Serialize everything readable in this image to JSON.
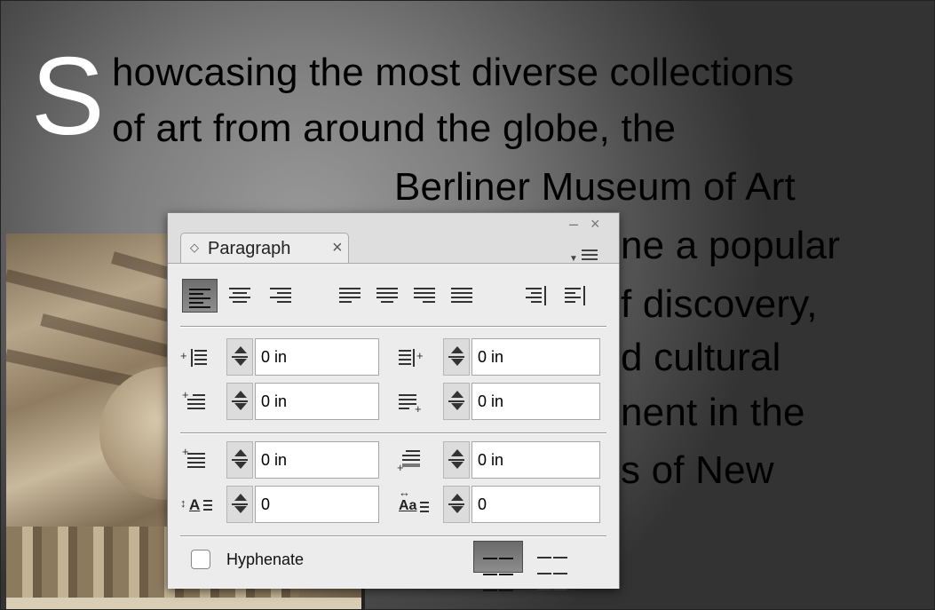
{
  "document": {
    "drop_cap": "S",
    "lines": [
      "howcasing the most diverse collections",
      "of art from around the globe, the",
      "Berliner Museum of Art",
      "ne a popular",
      "f discovery,",
      "d cultural",
      "nent in the",
      "s of New"
    ]
  },
  "panel": {
    "tab_label": "Paragraph",
    "tab_icon": "collapse-arrows-icon",
    "minimize_icon": "–",
    "close_icon": "×",
    "tab_close_icon": "×",
    "alignment_buttons": [
      "align-left",
      "align-center",
      "align-right",
      "justify-left",
      "justify-center",
      "justify-right",
      "justify-all",
      "align-towards-spine",
      "align-away-from-spine"
    ],
    "active_alignment": "align-left",
    "left_indent": "0 in",
    "right_indent": "0 in",
    "first_line_indent": "0 in",
    "last_line_right_indent": "0 in",
    "space_before": "0 in",
    "space_after": "0 in",
    "drop_cap_lines": "0",
    "drop_cap_characters": "0",
    "drop_cap_lines_icon_text": "A",
    "drop_cap_chars_icon_text": "Aa",
    "hyphenate_label": "Hyphenate",
    "hyphenate_checked": false,
    "composer": "single-line"
  }
}
